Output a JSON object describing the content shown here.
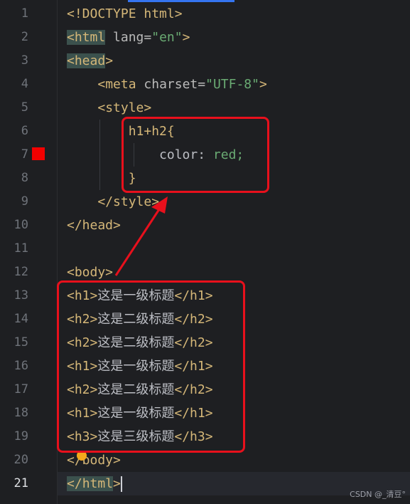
{
  "editor": {
    "line_numbers": [
      "1",
      "2",
      "3",
      "4",
      "5",
      "6",
      "7",
      "8",
      "9",
      "10",
      "11",
      "12",
      "13",
      "14",
      "15",
      "16",
      "17",
      "18",
      "19",
      "20",
      "21"
    ],
    "lines": {
      "l1": {
        "a": "<!DOCTYPE html>"
      },
      "l2": {
        "open": "<",
        "tag": "html",
        "attr": " lang=",
        "str": "\"en\"",
        "close": ">"
      },
      "l3": {
        "open": "<",
        "tag": "head",
        "close": ">"
      },
      "l4": {
        "indent": "    ",
        "open": "<",
        "tag": "meta",
        "attr": " charset=",
        "str": "\"UTF-8\"",
        "close": ">"
      },
      "l5": {
        "indent": "    ",
        "a": "<style>"
      },
      "l6": {
        "indent": "        ",
        "a": "h1+h2{"
      },
      "l7": {
        "indent": "            ",
        "prop": "color: ",
        "val": "red",
        "punct": ";"
      },
      "l8": {
        "indent": "        ",
        "a": "}"
      },
      "l9": {
        "indent": "    ",
        "a": "</style>"
      },
      "l10": {
        "a": "</head>"
      },
      "l12": {
        "a": "<body>"
      },
      "l13": {
        "o": "<h1>",
        "t": "这是一级标题",
        "c": "</h1>"
      },
      "l14": {
        "o": "<h2>",
        "t": "这是二级标题",
        "c": "</h2>"
      },
      "l15": {
        "o": "<h2>",
        "t": "这是二级标题",
        "c": "</h2>"
      },
      "l16": {
        "o": "<h1>",
        "t": "这是一级标题",
        "c": "</h1>"
      },
      "l17": {
        "o": "<h2>",
        "t": "这是二级标题",
        "c": "</h2>"
      },
      "l18": {
        "o": "<h1>",
        "t": "这是一级标题",
        "c": "</h1>"
      },
      "l19": {
        "o": "<h3>",
        "t": "这是三级标题",
        "c": "</h3>"
      },
      "l20": {
        "a": "</body>"
      },
      "l21": {
        "open": "</",
        "tag": "html",
        "close": ">"
      }
    },
    "active_line": "21"
  },
  "colors": {
    "annotation": "#e8101c",
    "breakpoint": "#f30000",
    "tag": "#d5b778",
    "string": "#6aab73"
  },
  "icons": [
    "breakpoint-icon",
    "intention-bulb-icon"
  ],
  "watermark": "CSDN @_清豆°"
}
